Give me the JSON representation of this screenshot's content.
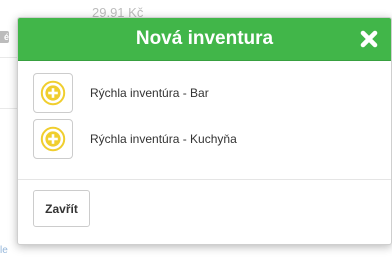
{
  "background": {
    "price_text": "29,91 Kč",
    "badge_text": "é",
    "link_text": "le"
  },
  "modal": {
    "title": "Nová inventura",
    "close_icon": "close-x-icon",
    "items": [
      {
        "label": "Rýchla inventúra - Bar",
        "icon": "plus-circle-icon"
      },
      {
        "label": "Rýchla inventúra - Kuchyňa",
        "icon": "plus-circle-icon"
      }
    ],
    "footer": {
      "close_label": "Zavřít"
    }
  },
  "colors": {
    "header_green": "#41b649",
    "icon_yellow": "#f0ce2e",
    "text": "#333333"
  }
}
